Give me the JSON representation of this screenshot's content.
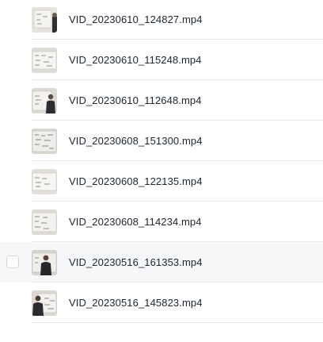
{
  "files": [
    {
      "name": "VID_20230610_124827.mp4",
      "thumbnail_icon": "video-thumbnail-icon",
      "selected": false
    },
    {
      "name": "VID_20230610_115248.mp4",
      "thumbnail_icon": "video-thumbnail-icon",
      "selected": false
    },
    {
      "name": "VID_20230610_112648.mp4",
      "thumbnail_icon": "video-thumbnail-icon",
      "selected": false
    },
    {
      "name": "VID_20230608_151300.mp4",
      "thumbnail_icon": "video-thumbnail-icon",
      "selected": false
    },
    {
      "name": "VID_20230608_122135.mp4",
      "thumbnail_icon": "video-thumbnail-icon",
      "selected": false
    },
    {
      "name": "VID_20230608_114234.mp4",
      "thumbnail_icon": "video-thumbnail-icon",
      "selected": false
    },
    {
      "name": "VID_20230516_161353.mp4",
      "thumbnail_icon": "video-thumbnail-icon",
      "selected": false,
      "hovered": true
    },
    {
      "name": "VID_20230516_145823.mp4",
      "thumbnail_icon": "video-thumbnail-icon",
      "selected": false
    }
  ],
  "colors": {
    "text": "#1c2530",
    "hover_background": "#f6f7f9",
    "divider": "#e8eaee"
  }
}
